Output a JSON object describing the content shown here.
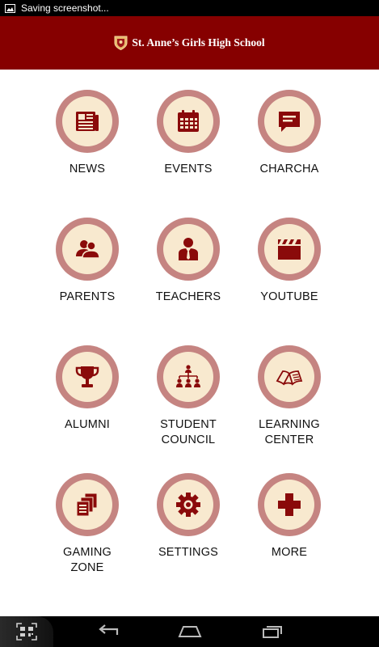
{
  "status_bar": {
    "notification": "Saving screenshot..."
  },
  "header": {
    "title": "St. Anne’s Girls High School"
  },
  "menu": [
    {
      "label": "NEWS",
      "icon": "newspaper-icon"
    },
    {
      "label": "EVENTS",
      "icon": "calendar-icon"
    },
    {
      "label": "CHARCHA",
      "icon": "chat-icon"
    },
    {
      "label": "PARENTS",
      "icon": "parents-icon"
    },
    {
      "label": "TEACHERS",
      "icon": "teacher-icon"
    },
    {
      "label": "YOUTUBE",
      "icon": "clapperboard-icon"
    },
    {
      "label": "ALUMNI",
      "icon": "trophy-icon"
    },
    {
      "label": "STUDENT\nCOUNCIL",
      "icon": "org-chart-icon"
    },
    {
      "label": "LEARNING\nCENTER",
      "icon": "open-book-icon"
    },
    {
      "label": "GAMING\nZONE",
      "icon": "documents-icon"
    },
    {
      "label": "SETTINGS",
      "icon": "gear-icon"
    },
    {
      "label": "MORE",
      "icon": "plus-icon"
    }
  ],
  "colors": {
    "header": "#860000",
    "icon": "#8a0a0a",
    "ring": "#c58481",
    "disc": "#f8e9cf"
  }
}
